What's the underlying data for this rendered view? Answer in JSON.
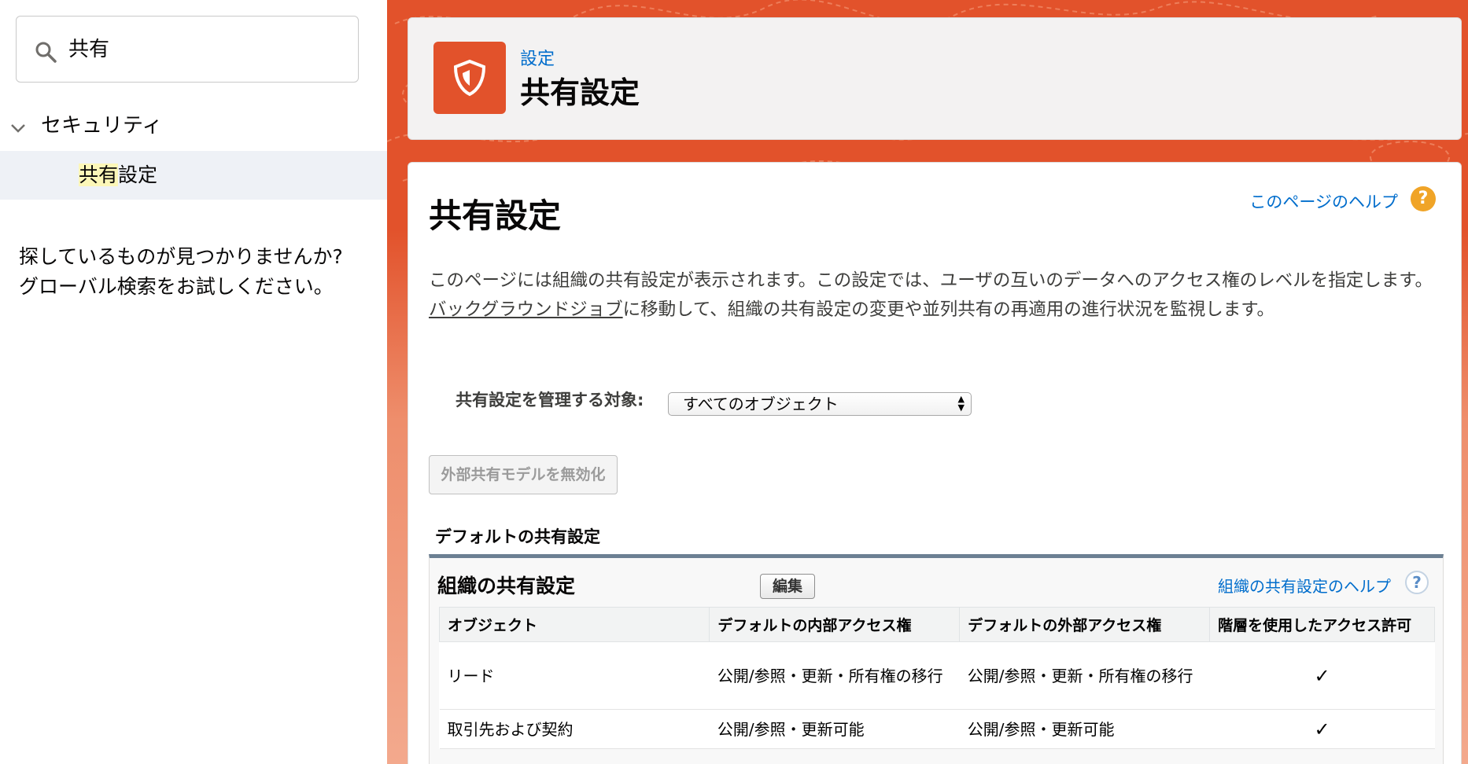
{
  "sidebar": {
    "search_value": "共有",
    "tree_parent": "セキュリティ",
    "tree_child_highlight": "共有",
    "tree_child_rest": "設定",
    "not_found_line1": "探しているものが見つかりませんか?",
    "not_found_line2": "グローバル検索をお試しください。"
  },
  "header": {
    "breadcrumb": "設定",
    "title": "共有設定"
  },
  "main": {
    "heading": "共有設定",
    "help_link": "このページのヘルプ",
    "help_icon": "?",
    "description_part1": "このページには組織の共有設定が表示されます。この設定では、ユーザの互いのデータへのアクセス権のレベルを指定します。",
    "description_link": "バックグラウンドジョブ",
    "description_part2": "に移動して、組織の共有設定の変更や並列共有の再適用の進行状況を監視します。",
    "manage_label": "共有設定を管理する対象:",
    "manage_select_value": "すべてのオブジェクト",
    "disable_button": "外部共有モデルを無効化",
    "section_title": "デフォルトの共有設定"
  },
  "org_block": {
    "title": "組織の共有設定",
    "edit_button": "編集",
    "help_link": "組織の共有設定のヘルプ",
    "help_icon": "?",
    "columns": [
      "オブジェクト",
      "デフォルトの内部アクセス権",
      "デフォルトの外部アクセス権",
      "階層を使用したアクセス許可"
    ],
    "rows": [
      {
        "object": "リード",
        "internal": "公開/参照・更新・所有権の移行",
        "external": "公開/参照・更新・所有権の移行",
        "hierarchy": "✓"
      },
      {
        "object": "取引先および契約",
        "internal": "公開/参照・更新可能",
        "external": "公開/参照・更新可能",
        "hierarchy": "✓"
      }
    ]
  },
  "colors": {
    "brand_orange": "#e2522b",
    "link_blue": "#006dcc",
    "help_orange": "#f0a427"
  }
}
